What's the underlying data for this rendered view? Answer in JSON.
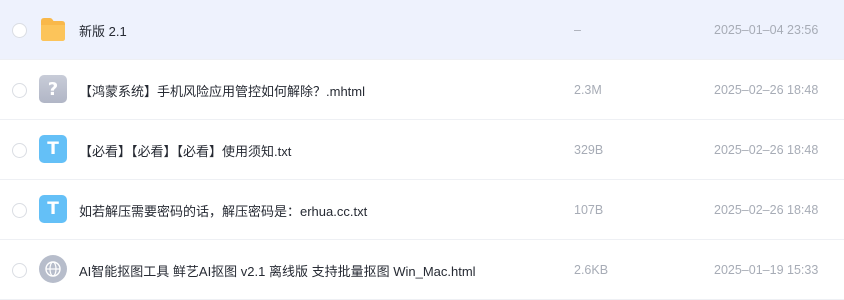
{
  "files": [
    {
      "name": "新版 2.1",
      "size": "–",
      "date": "2025–01–04 23:56",
      "icon": "folder-icon",
      "selected": true
    },
    {
      "name": "【鸿蒙系统】手机风险应用管控如何解除？.mhtml",
      "size": "2.3M",
      "date": "2025–02–26 18:48",
      "icon": "unknown-file-icon",
      "glyph": "?"
    },
    {
      "name": "【必看】【必看】【必看】使用须知.txt",
      "size": "329B",
      "date": "2025–02–26 18:48",
      "icon": "txt-file-icon",
      "glyph": "T"
    },
    {
      "name": "如若解压需要密码的话，解压密码是：erhua.cc.txt",
      "size": "107B",
      "date": "2025–02–26 18:48",
      "icon": "txt-file-icon",
      "glyph": "T"
    },
    {
      "name": "AI智能抠图工具 鲜艺AI抠图 v2.1 离线版 支持批量抠图 Win_Mac.html",
      "size": "2.6KB",
      "date": "2025–01–19 15:33",
      "icon": "html-globe-icon"
    }
  ],
  "colors": {
    "selected_row_bg": "#eef2fd",
    "txt_icon": "#64c0f7",
    "folder_icon": "#f9b84a",
    "meta_text": "#a7acb6"
  }
}
